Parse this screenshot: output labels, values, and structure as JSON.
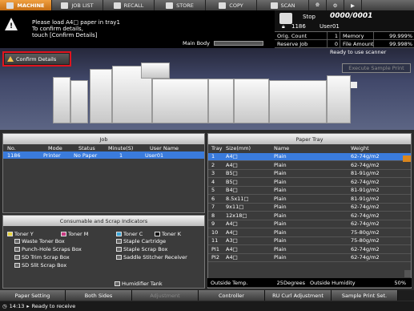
{
  "top_tabs": [
    {
      "label": "MACHINE",
      "icon": "machine-icon",
      "active": true
    },
    {
      "label": "JOB LIST",
      "icon": "job-list-icon",
      "active": false
    },
    {
      "label": "RECALL",
      "icon": "recall-icon",
      "active": false
    },
    {
      "label": "STORE",
      "icon": "store-icon",
      "active": false
    },
    {
      "label": "COPY",
      "icon": "copy-icon",
      "active": false
    },
    {
      "label": "SCAN",
      "icon": "scan-icon",
      "active": false
    },
    {
      "label": "",
      "icon": "globe-icon",
      "active": false
    },
    {
      "label": "",
      "icon": "settings-icon",
      "active": false
    },
    {
      "label": "",
      "icon": "arrow-right-icon",
      "active": false
    }
  ],
  "message": {
    "line1": "Please load   A4□    paper in tray1",
    "line2": "To confirm details,",
    "line3": "touch [Confirm Details]",
    "main_body_label": "Main Body"
  },
  "status": {
    "state": "Stop",
    "counter": "0000/0001",
    "job_number": "1186",
    "user": "User01",
    "orig_count_label": "Orig. Count",
    "orig_count_value": "1",
    "memory_label": "Memory",
    "memory_value": "99.999%",
    "reserve_job_label": "Reserve Job",
    "reserve_job_value": "0",
    "file_amount_label": "File Amount",
    "file_amount_value": "99.998%"
  },
  "machine": {
    "confirm_details_label": "Confirm Details",
    "ready_text": "Ready to use scanner",
    "execute_sample_label": "Execute Sample Print"
  },
  "job_panel": {
    "title": "Job",
    "headers": [
      "No.",
      "Mode",
      "Status",
      "Minute(S)",
      "User Name"
    ],
    "rows": [
      [
        "1186",
        "Printer",
        "No Paper",
        "1",
        "User01"
      ]
    ]
  },
  "consumables": {
    "title": "Consumable and Scrap Indicators",
    "toners": [
      "Toner Y",
      "Toner M",
      "Toner C",
      "Toner K"
    ],
    "col1": [
      "Waste Toner Box",
      "Punch-Hole Scraps Box",
      "SD Trim Scrap Box",
      "SD Slit Scrap Box"
    ],
    "col2": [
      "Staple Cartridge",
      "Staple Scrap Box",
      "Saddle Stitcher Receiver"
    ],
    "humidifier": "Humidifier Tank"
  },
  "tray_panel": {
    "title": "Paper Tray",
    "headers": [
      "Tray",
      "Size(mm)",
      "Name",
      "Weight"
    ],
    "rows": [
      [
        "1",
        "A4□",
        "Plain",
        "62-74g/m2"
      ],
      [
        "2",
        "A4□",
        "Plain",
        "62-74g/m2"
      ],
      [
        "3",
        "B5□",
        "Plain",
        "81-91g/m2"
      ],
      [
        "4",
        "B5□",
        "Plain",
        "62-74g/m2"
      ],
      [
        "5",
        "B4□",
        "Plain",
        "81-91g/m2"
      ],
      [
        "6",
        "8.5x11□",
        "Plain",
        "81-91g/m2"
      ],
      [
        "7",
        "9x11□",
        "Plain",
        "62-74g/m2"
      ],
      [
        "8",
        "12x18□",
        "Plain",
        "62-74g/m2"
      ],
      [
        "9",
        "A4□",
        "Plain",
        "62-74g/m2"
      ],
      [
        "10",
        "A4□",
        "Plain",
        "75-80g/m2"
      ],
      [
        "11",
        "A3□",
        "Plain",
        "75-80g/m2"
      ],
      [
        "PI1",
        "A4□",
        "Plain",
        "62-74g/m2"
      ],
      [
        "PI2",
        "A4□",
        "Plain",
        "62-74g/m2"
      ]
    ],
    "outside_temp_label": "Outside Temp.",
    "outside_temp_value": "25Degrees",
    "outside_humidity_label": "Outside Humidity",
    "outside_humidity_value": "50%"
  },
  "bottom_buttons": [
    {
      "label": "Paper Setting",
      "enabled": true
    },
    {
      "label": "Both Sides",
      "enabled": true
    },
    {
      "label": "Adjustment",
      "enabled": false
    },
    {
      "label": "Controller",
      "enabled": true
    },
    {
      "label": "RU Curl Adjustment",
      "enabled": true
    },
    {
      "label": "Sample Print Set.",
      "enabled": true
    }
  ],
  "status_line": {
    "time": "14:13",
    "text": "Ready to receive"
  },
  "colors": {
    "accent_orange": "#d9861e",
    "selection_blue": "#3a7bdc",
    "highlight_red": "#e0141e"
  }
}
